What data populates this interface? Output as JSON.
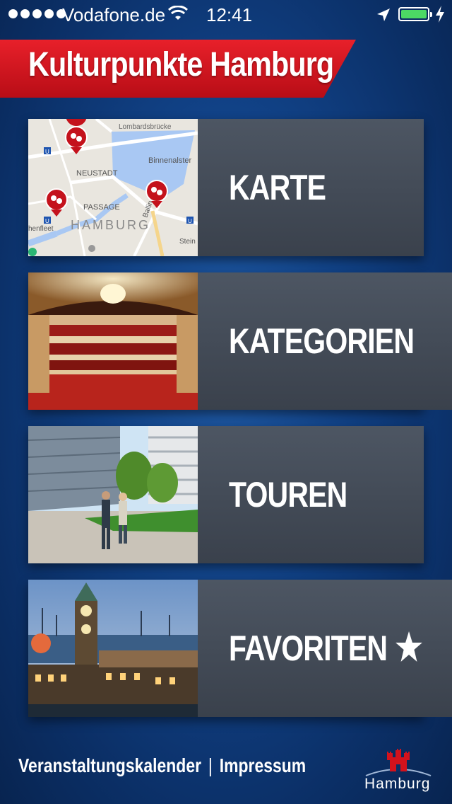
{
  "status": {
    "carrier": "Vodafone.de",
    "time": "12:41",
    "battery_level": 1.0
  },
  "header": {
    "title": "Kulturpunkte Hamburg"
  },
  "tiles": [
    {
      "label": "KARTE",
      "image": "map-thumbnail",
      "map_labels": {
        "lombardsbrucke": "Lombardsbrücke",
        "binnenalster": "Binnenalster",
        "neustadt": "NEUSTADT",
        "passage": "PASSAGE",
        "hamburg": "HAMBURG",
        "fleet": "henfleet",
        "steinstr": "Stein",
        "ballindamm": "Ballindamm"
      }
    },
    {
      "label": "KATEGORIEN",
      "image": "theater-photo"
    },
    {
      "label": "TOUREN",
      "image": "walking-couple-photo"
    },
    {
      "label": "FAVORITEN",
      "image": "harbour-tower-photo",
      "icon": "star-icon"
    }
  ],
  "footer": {
    "calendar_link": "Veranstaltungskalender",
    "separator": "|",
    "imprint_link": "Impressum",
    "logo_text": "Hamburg"
  },
  "colors": {
    "background": "#114287",
    "banner_red": "#d3121c",
    "tile_gray": "#444c58",
    "battery_green": "#4cd964"
  }
}
